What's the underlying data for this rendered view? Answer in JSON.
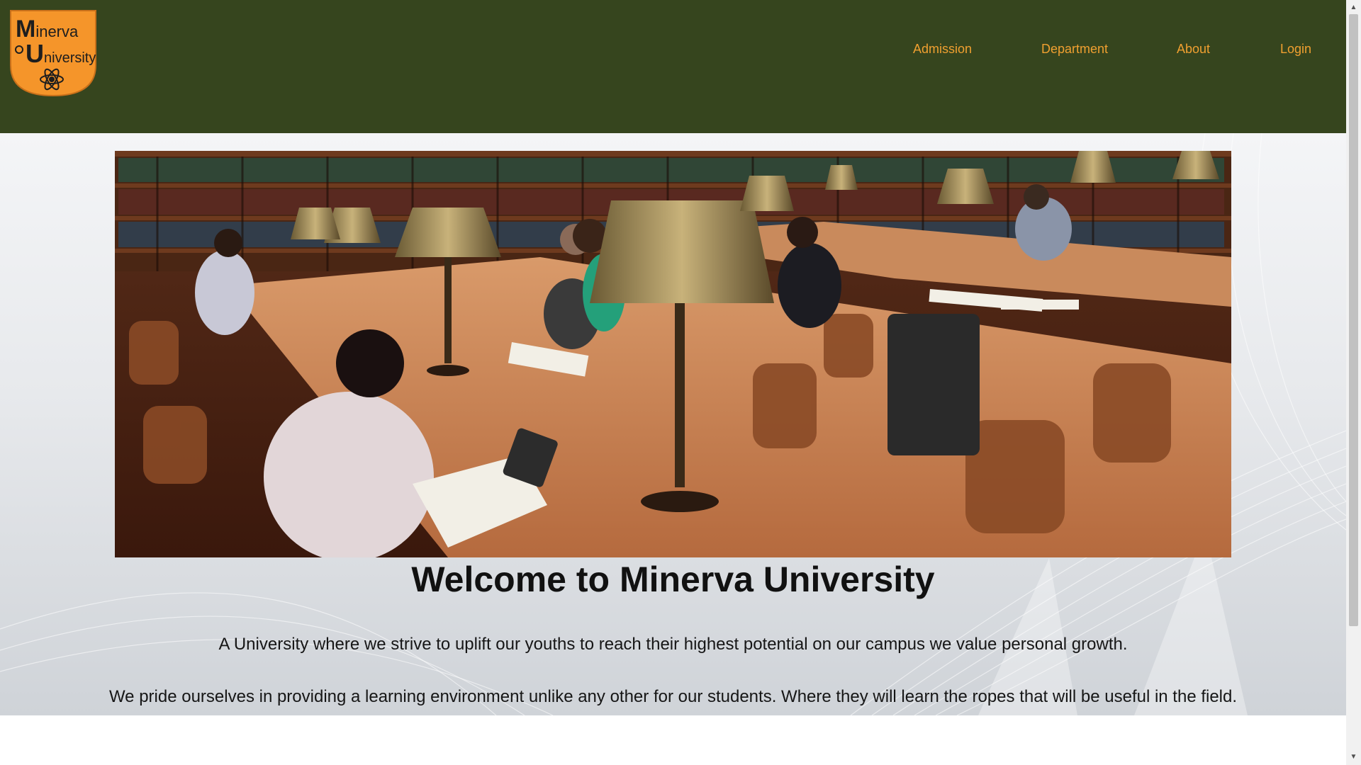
{
  "brand": {
    "logo_line1": "Minerva",
    "logo_line2": "University",
    "logo_bg": "#f5952a",
    "header_bg": "#36451e",
    "nav_color": "#f0a030"
  },
  "nav": {
    "admission": "Admission",
    "department": "Department",
    "about": "About",
    "login": "Login"
  },
  "hero": {
    "photo_icon": "library-reading-room-photo",
    "title": "Welcome to Minerva University",
    "paragraph1": "A University where we strive to uplift our youths to reach their highest potential on our campus we value personal growth.",
    "paragraph2": "We pride ourselves in providing a learning environment unlike any other for our students. Where they will learn the ropes that will be useful in the field."
  }
}
